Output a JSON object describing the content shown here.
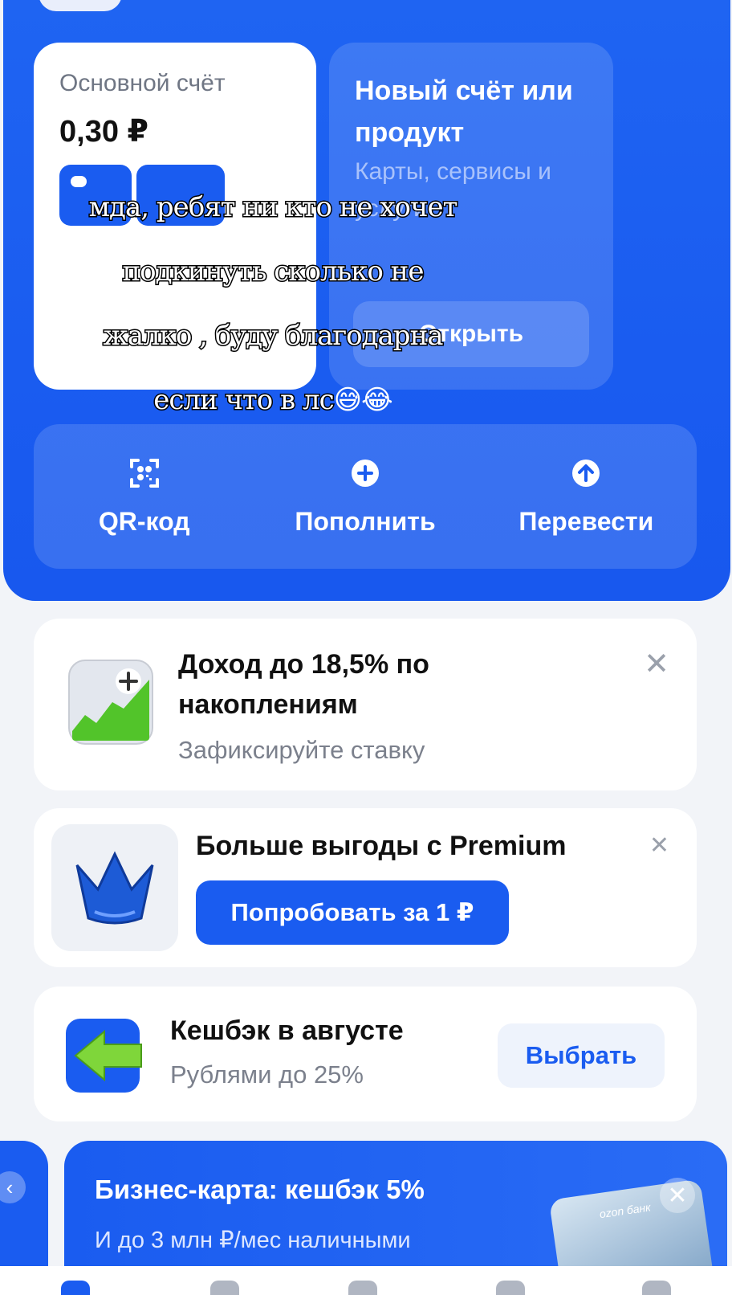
{
  "account": {
    "title": "Основной счёт",
    "balance": "0,30 ₽"
  },
  "new_product": {
    "title": "Новый счёт или продукт",
    "subtitle": "Карты, сервисы и услуги",
    "open_label": "Открыть"
  },
  "actions": [
    {
      "label": "QR-код",
      "icon": "qr-code-icon"
    },
    {
      "label": "Пополнить",
      "icon": "plus-circle-icon"
    },
    {
      "label": "Перевести",
      "icon": "arrow-up-circle-icon"
    }
  ],
  "overlay": {
    "lines": [
      "мда, ребят ни кто не хочет",
      "подкинуть сколько не",
      "жалко , буду благодарна",
      "если что в лс"
    ],
    "emoji": "😅😂"
  },
  "savings_card": {
    "title": "Доход до 18,5% по накоплениям",
    "subtitle": "Зафиксируйте ставку",
    "close": "✕"
  },
  "premium_card": {
    "title": "Больше выгоды с Premium",
    "button": "Попробовать за 1 ₽",
    "close": "✕"
  },
  "cashback_card": {
    "title": "Кешбэк в августе",
    "subtitle": "Рублями до 25%",
    "button": "Выбрать"
  },
  "business_card": {
    "title": "Бизнес-карта: кешбэк 5%",
    "subtitle": "И до 3 млн ₽/мес наличными",
    "card_logo": "ozon банк",
    "close": "✕"
  },
  "colors": {
    "primary": "#1a5cf0",
    "card_bg": "#ffffff",
    "page_bg": "#f2f4f8"
  }
}
